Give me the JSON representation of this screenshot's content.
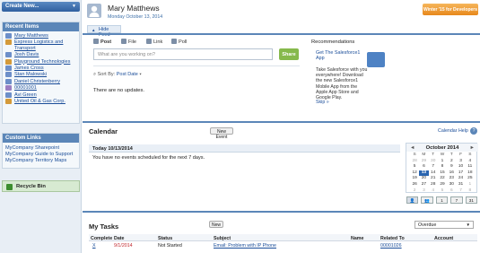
{
  "sidebar": {
    "create_new": "Create New...",
    "recent_title": "Recent Items",
    "recent_items": [
      {
        "label": "Mary Matthews",
        "icon": "contact-icon",
        "color": "#6d8fc9"
      },
      {
        "label": "Express Logistics and Transport",
        "icon": "account-icon",
        "color": "#d49a3a"
      },
      {
        "label": "Josh Davis",
        "icon": "contact-icon",
        "color": "#6d8fc9"
      },
      {
        "label": "Playground Technologies",
        "icon": "account-icon",
        "color": "#d49a3a"
      },
      {
        "label": "James Cross",
        "icon": "contact-icon",
        "color": "#6d8fc9"
      },
      {
        "label": "Stan Malowski",
        "icon": "contact-icon",
        "color": "#6d8fc9"
      },
      {
        "label": "Daniel Christenberry",
        "icon": "contact-icon",
        "color": "#6d8fc9"
      },
      {
        "label": "00001001",
        "icon": "case-icon",
        "color": "#9b7ec2"
      },
      {
        "label": "Avi Green",
        "icon": "contact-icon",
        "color": "#6d8fc9"
      },
      {
        "label": "United Oil & Gas Corp.",
        "icon": "account-icon",
        "color": "#d49a3a"
      }
    ],
    "custom_links_title": "Custom Links",
    "custom_links": [
      "MyCompany Sharepoint",
      "MyCompany Guide to Support",
      "MyCompany Territory Maps"
    ],
    "recycle_bin": "Recycle Bin"
  },
  "header": {
    "user_name": "Mary Matthews",
    "date": "Monday October 13, 2014",
    "promo": "Winter '15 for Developers",
    "hide_feed": "Hide Feed"
  },
  "publisher": {
    "tabs": [
      "Post",
      "File",
      "Link",
      "Poll"
    ],
    "placeholder": "What are you working on?",
    "share": "Share",
    "sort_label": "Sort By:",
    "sort_value": "Post Date",
    "no_updates": "There are no updates."
  },
  "recommendations": {
    "title": "Recommendations",
    "link": "Get The Salesforce1 App",
    "body": "Take Salesforce with you everywhere! Download the new Salesforce1 Mobile App from the Apple App Store and Google Play.",
    "skip": "Skip »"
  },
  "calendar": {
    "title": "Calendar",
    "new_event": "New Event",
    "help": "Calendar Help",
    "help_q": "?",
    "today_label": "Today 10/13/2014",
    "no_events": "You have no events scheduled for the next 7 days.",
    "month": "October 2014",
    "prev": "◄",
    "next": "►",
    "weekdays": [
      "S",
      "M",
      "T",
      "W",
      "T",
      "F",
      "S"
    ],
    "days": [
      [
        "28",
        "29",
        "30",
        "1",
        "2",
        "3",
        "4"
      ],
      [
        "5",
        "6",
        "7",
        "8",
        "9",
        "10",
        "11"
      ],
      [
        "12",
        "13",
        "14",
        "15",
        "16",
        "17",
        "18"
      ],
      [
        "19",
        "20",
        "21",
        "22",
        "23",
        "24",
        "25"
      ],
      [
        "26",
        "27",
        "28",
        "29",
        "30",
        "31",
        "1"
      ],
      [
        "2",
        "3",
        "4",
        "5",
        "6",
        "7",
        "8"
      ]
    ],
    "today_day": "13",
    "view_buttons": [
      "1",
      "7",
      "31"
    ]
  },
  "tasks": {
    "title": "My Tasks",
    "new": "New",
    "filter": "Overdue",
    "columns": [
      "Complete",
      "Date",
      "Status",
      "Subject",
      "Name",
      "Related To",
      "Account"
    ],
    "rows": [
      {
        "complete": "X",
        "date": "9/1/2014",
        "status": "Not Started",
        "subject": "Email: Problem with IP Phone",
        "name": "",
        "related": "00001026",
        "account": ""
      }
    ]
  }
}
